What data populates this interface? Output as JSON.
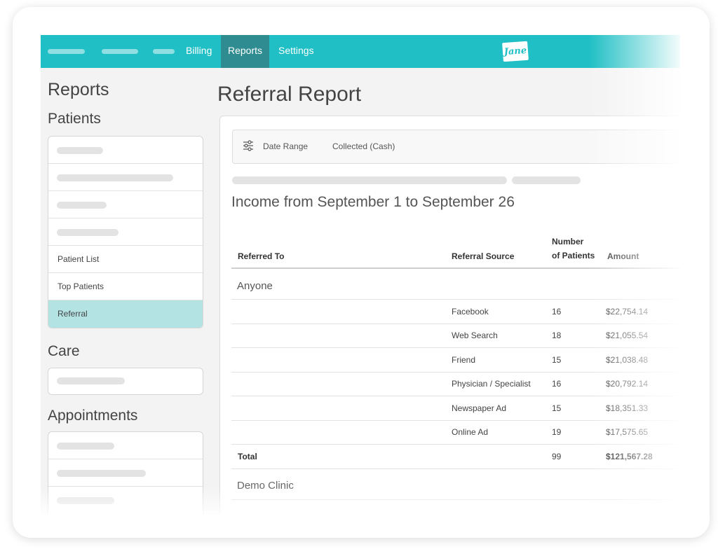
{
  "nav": {
    "items": [
      {
        "label": "Billing",
        "active": false
      },
      {
        "label": "Reports",
        "active": true
      },
      {
        "label": "Settings",
        "active": false
      }
    ],
    "logo_text": "Jane",
    "accent": "#1fbfc5",
    "active_bg": "#2f8c91"
  },
  "sidebar": {
    "title": "Reports",
    "sections": [
      {
        "heading": "Patients",
        "items": [
          "",
          "",
          "",
          "",
          "Patient List",
          "Top Patients",
          "Referral"
        ],
        "active": "Referral"
      },
      {
        "heading": "Care",
        "items": [
          ""
        ]
      },
      {
        "heading": "Appointments",
        "items": [
          "",
          "",
          ""
        ]
      }
    ]
  },
  "main": {
    "title": "Referral Report",
    "filters": {
      "icon": "filter-sliders-icon",
      "date_range": "Date Range",
      "collected": "Collected (Cash)"
    },
    "income_heading": "Income from September 1 to September 26",
    "table": {
      "headers": {
        "referred_to": "Referred To",
        "referral_source": "Referral Source",
        "number_of_patients_line1": "Number",
        "number_of_patients_line2": "of Patients",
        "amount": "Amount"
      },
      "groups": [
        {
          "name": "Anyone",
          "rows": [
            {
              "source": "Facebook",
              "patients": "16",
              "amount": "$22,754.14"
            },
            {
              "source": "Web Search",
              "patients": "18",
              "amount": "$21,055.54"
            },
            {
              "source": "Friend",
              "patients": "15",
              "amount": "$21,038.48"
            },
            {
              "source": "Physician / Specialist",
              "patients": "16",
              "amount": "$20,792.14"
            },
            {
              "source": "Newspaper Ad",
              "patients": "15",
              "amount": "$18,351.33"
            },
            {
              "source": "Online Ad",
              "patients": "19",
              "amount": "$17,575.65"
            }
          ],
          "total": {
            "label": "Total",
            "patients": "99",
            "amount": "$121,567.28"
          }
        },
        {
          "name": "Demo Clinic"
        }
      ]
    }
  }
}
